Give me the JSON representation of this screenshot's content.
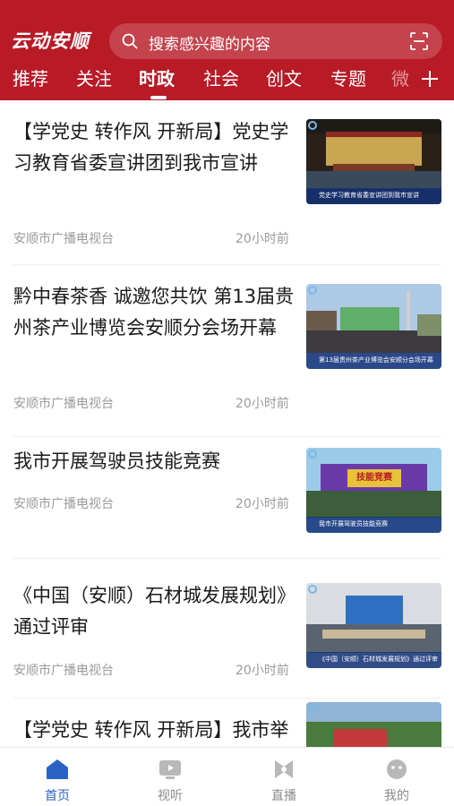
{
  "header": {
    "logo_text": "云动安顺",
    "search_placeholder": "搜索感兴趣的内容",
    "tabs": [
      {
        "label": "推荐"
      },
      {
        "label": "关注"
      },
      {
        "label": "时政",
        "active": true
      },
      {
        "label": "社会"
      },
      {
        "label": "创文"
      },
      {
        "label": "专题"
      }
    ],
    "tab_overflow": "微"
  },
  "feed": [
    {
      "title": "【学党史 转作风 开新局】党史学习教育省委宣讲团到我市宣讲",
      "source": "安顺市广播电视台",
      "time": "20小时前",
      "thumb_caption": "党史学习教育省委宣讲团到我市宣讲"
    },
    {
      "title": "黔中春茶香 诚邀您共饮 第13届贵州茶产业博览会安顺分会场开幕",
      "source": "安顺市广播电视台",
      "time": "20小时前",
      "thumb_caption": "第13届贵州茶产业博览会安顺分会场开幕"
    },
    {
      "title": "我市开展驾驶员技能竞赛",
      "source": "安顺市广播电视台",
      "time": "20小时前",
      "thumb_caption": "我市开展驾驶员技能竞赛",
      "thumb_banner": "技能竞赛"
    },
    {
      "title": "《中国（安顺）石材城发展规划》通过评审",
      "source": "安顺市广播电视台",
      "time": "20小时前",
      "thumb_caption": "《中国（安顺）石材城发展规划》通过评审"
    },
    {
      "title": "【学党史 转作风 开新局】我市举行“中娟学党史 守记忆初喂",
      "source": "",
      "time": "",
      "thumb_caption": ""
    }
  ],
  "bottom_nav": [
    {
      "label": "首页",
      "icon": "home-icon",
      "active": true
    },
    {
      "label": "视听",
      "icon": "tv-icon"
    },
    {
      "label": "直播",
      "icon": "live-icon"
    },
    {
      "label": "我的",
      "icon": "profile-icon"
    }
  ],
  "colors": {
    "brand_red": "#b81a26",
    "active_blue": "#2a63c4"
  }
}
